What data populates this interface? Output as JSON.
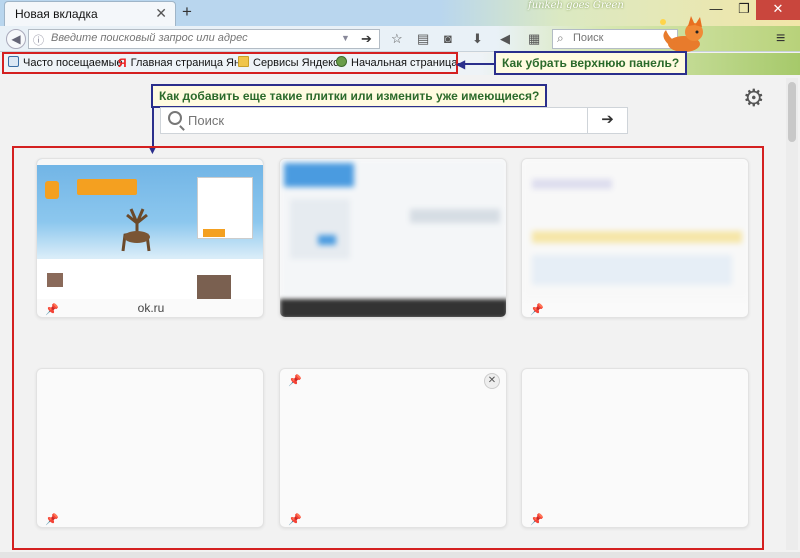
{
  "tab": {
    "title": "Новая вкладка",
    "close": "✕",
    "new_tab": "+"
  },
  "theme": {
    "label": "funkeh goes Green"
  },
  "window": {
    "minimize": "—",
    "maximize": "❐",
    "close": "✕"
  },
  "navbar": {
    "back": "◀",
    "url_placeholder": "Введите поисковый запрос или адрес",
    "url_dropdown": "▼",
    "go": "➔",
    "search_placeholder": "Поиск",
    "menu": "≡"
  },
  "bookmarks": {
    "items": [
      {
        "label": "Часто посещаемые",
        "icon": "clock-icon"
      },
      {
        "label": "Главная страница Ян...",
        "icon": "yandex-icon"
      },
      {
        "label": "Сервисы Яндекса",
        "icon": "folder-icon"
      },
      {
        "label": "Начальная страница",
        "icon": "globe-icon"
      }
    ]
  },
  "callouts": {
    "top_panel": "Как убрать верхнюю панель?",
    "tiles": "Как добавить еще такие плитки или изменить уже имеющиеся?"
  },
  "content": {
    "search_placeholder": "Поиск",
    "search_go": "➔",
    "tiles": [
      {
        "caption": "ok.ru",
        "pinned": true,
        "blurred": false
      },
      {
        "caption": "",
        "pinned": false,
        "blurred": true
      },
      {
        "caption": "",
        "pinned": true,
        "blurred": true
      },
      {
        "caption": "",
        "pinned": true,
        "blurred": false,
        "empty": true
      },
      {
        "caption": "",
        "pinned": true,
        "blurred": false,
        "empty": true,
        "has_close": true
      },
      {
        "caption": "",
        "pinned": true,
        "blurred": false,
        "empty": true
      }
    ]
  },
  "colors": {
    "highlight_red": "#d42020",
    "callout_border": "#2b2f8c",
    "callout_text": "#2b6a2b",
    "callout_bg": "#fffbe0"
  }
}
